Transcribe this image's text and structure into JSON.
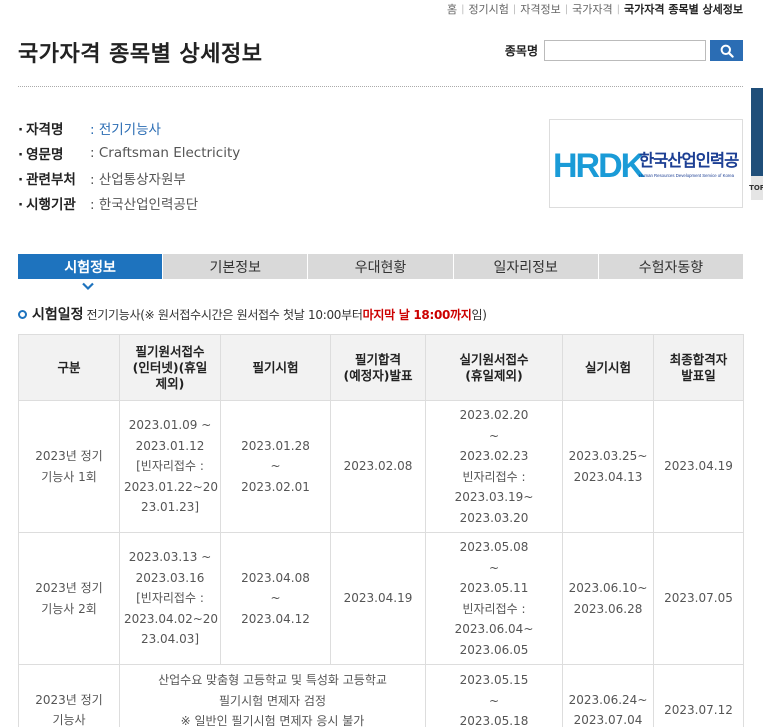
{
  "breadcrumb": [
    "홈",
    "정기시험",
    "자격정보",
    "국가자격",
    "국가자격 종목별 상세정보"
  ],
  "page_title": "국가자격 종목별 상세정보",
  "search": {
    "label": "종목명",
    "value": "",
    "placeholder": ""
  },
  "info": [
    {
      "label": "자격명",
      "value": ": 전기기능사"
    },
    {
      "label": "영문명",
      "value": ": Craftsman Electricity"
    },
    {
      "label": "관련부처",
      "value": ": 산업통상자원부"
    },
    {
      "label": "시행기관",
      "value": ": 한국산업인력공단"
    }
  ],
  "logo": {
    "mark": "HRDK",
    "name": "한국산업인력공단",
    "sub": "Human Resources Development Service of Korea"
  },
  "side_widget": {
    "text": "TOP"
  },
  "tabs": [
    "시험정보",
    "기본정보",
    "우대현황",
    "일자리정보",
    "수험자동향"
  ],
  "section": {
    "title": "시험일정",
    "sub_prefix": "전기기능사(※ 원서접수시간은 원서접수 첫날 10:00부터 ",
    "sub_red": "마지막 날 18:00까지",
    "sub_suffix": "임)"
  },
  "table": {
    "headers": [
      "구분",
      "필기원서접수\n(인터넷)(휴일\n제외)",
      "필기시험",
      "필기합격\n(예정자)발표",
      "실기원서접수\n(휴일제외)",
      "실기시험",
      "최종합격자\n발표일"
    ],
    "rows": [
      [
        "2023년 정기\n기능사 1회",
        "2023.01.09 ~\n2023.01.12\n[빈자리접수 :\n2023.01.22~20\n23.01.23]",
        "2023.01.28\n~\n2023.02.01",
        "2023.02.08",
        "2023.02.20\n~\n2023.02.23\n빈자리접수 :\n2023.03.19~\n2023.03.20",
        "2023.03.25~\n2023.04.13",
        "2023.04.19"
      ],
      [
        "2023년 정기\n기능사 2회",
        "2023.03.13 ~\n2023.03.16\n[빈자리접수 :\n2023.04.02~20\n23.04.03]",
        "2023.04.08\n~\n2023.04.12",
        "2023.04.19",
        "2023.05.08\n~\n2023.05.11\n빈자리접수 :\n2023.06.04~\n2023.06.05",
        "2023.06.10~\n2023.06.28",
        "2023.07.05"
      ],
      [
        "2023년 정기\n기능사",
        "산업수요 맞춤형 고등학교 및 특성화 고등학교\n필기시험 면제자 검정\n※ 일반인 필기시험 면제자 응시 불가",
        "2023.05.15\n~\n2023.05.18",
        "2023.06.24~\n2023.07.04",
        "2023.07.12"
      ]
    ]
  },
  "colors": {
    "accent": "#1e73be",
    "tab_bg": "#d9d9d9",
    "red": "#cc0000",
    "logo_blue": "#1a9bd7",
    "logo_dark": "#1c3f94"
  }
}
